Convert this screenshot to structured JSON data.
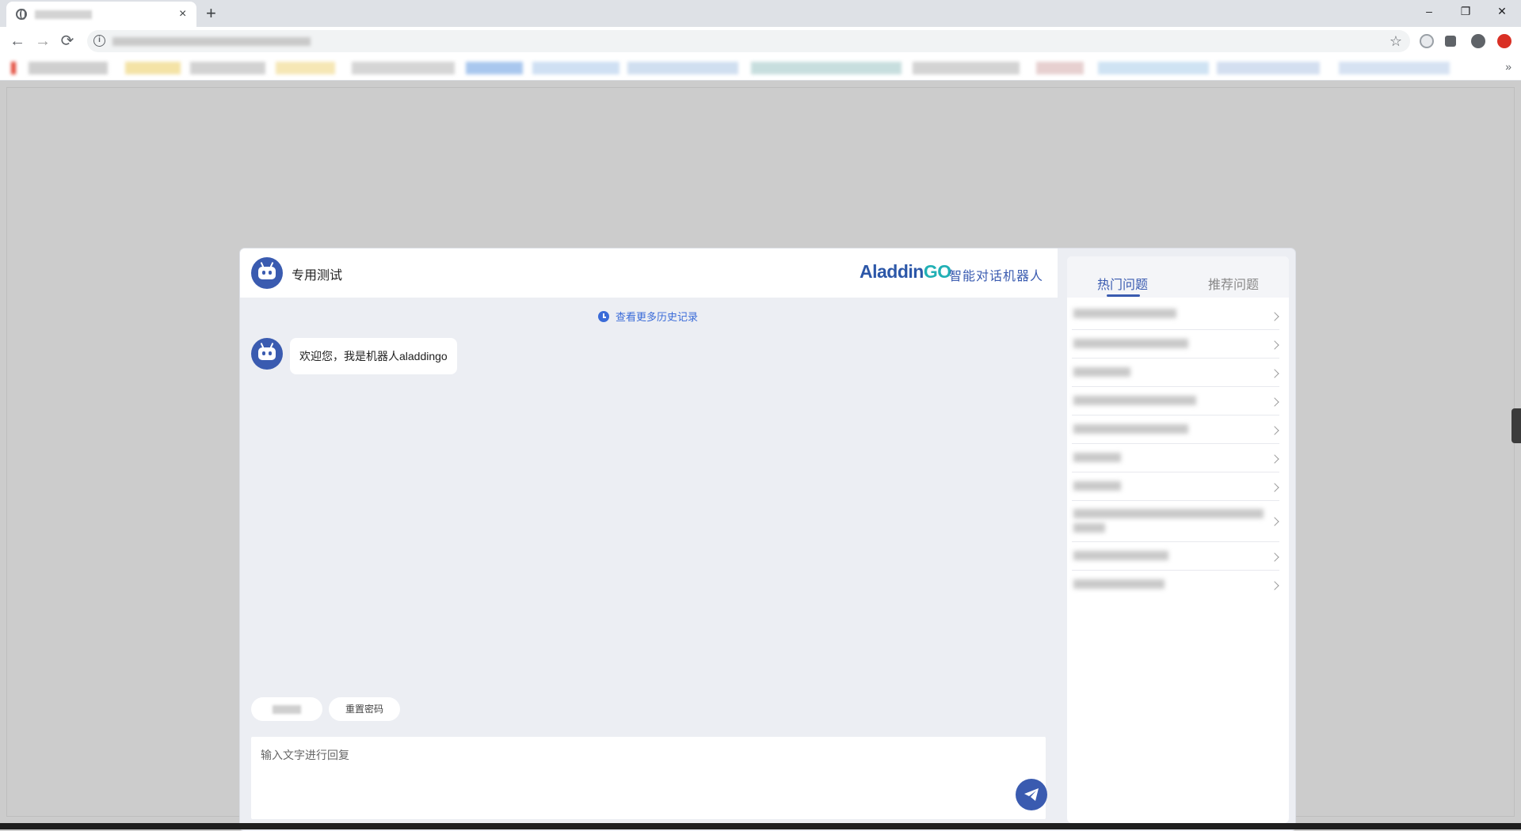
{
  "browser": {
    "tab_close": "×",
    "new_tab": "+",
    "window_controls": {
      "minimize": "–",
      "restore": "❐",
      "close": "✕"
    },
    "nav": {
      "back": "←",
      "forward": "→",
      "reload": "⟳"
    },
    "bookmarks_more": "»"
  },
  "chat": {
    "header_title": "专用测试",
    "brand": {
      "logo_main": "Aladdin",
      "logo_accent": "GO",
      "subtitle": "智能对话机器人"
    },
    "history_link": "查看更多历史记录",
    "messages": [
      {
        "sender": "bot",
        "text": "欢迎您，我是机器人aladdingo"
      }
    ],
    "quick_replies": [
      {
        "label": ""
      },
      {
        "label": "重置密码"
      }
    ],
    "input_placeholder": "输入文字进行回复"
  },
  "side_panel": {
    "tabs": [
      {
        "label": "热门问题",
        "active": true
      },
      {
        "label": "推荐问题",
        "active": false
      }
    ]
  },
  "colors": {
    "primary": "#3a5bb0",
    "link": "#3a6bd8",
    "brand_accent": "#21b0b5",
    "page_background": "#cccccc",
    "chat_background": "#eceef3"
  }
}
